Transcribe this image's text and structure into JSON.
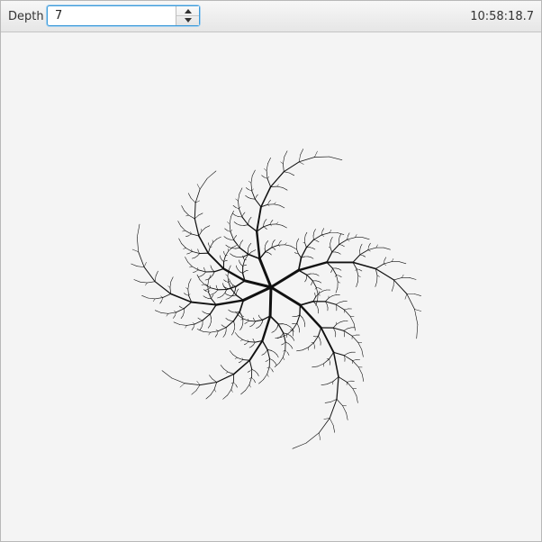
{
  "toolbar": {
    "depth_label": "Depth",
    "depth_value": "7",
    "clock": "10:58:18.7"
  },
  "fractal": {
    "depth": 7,
    "stroke_color": "#111111"
  },
  "icons": {
    "spin_up": "triangle-up-icon",
    "spin_down": "triangle-down-icon"
  }
}
